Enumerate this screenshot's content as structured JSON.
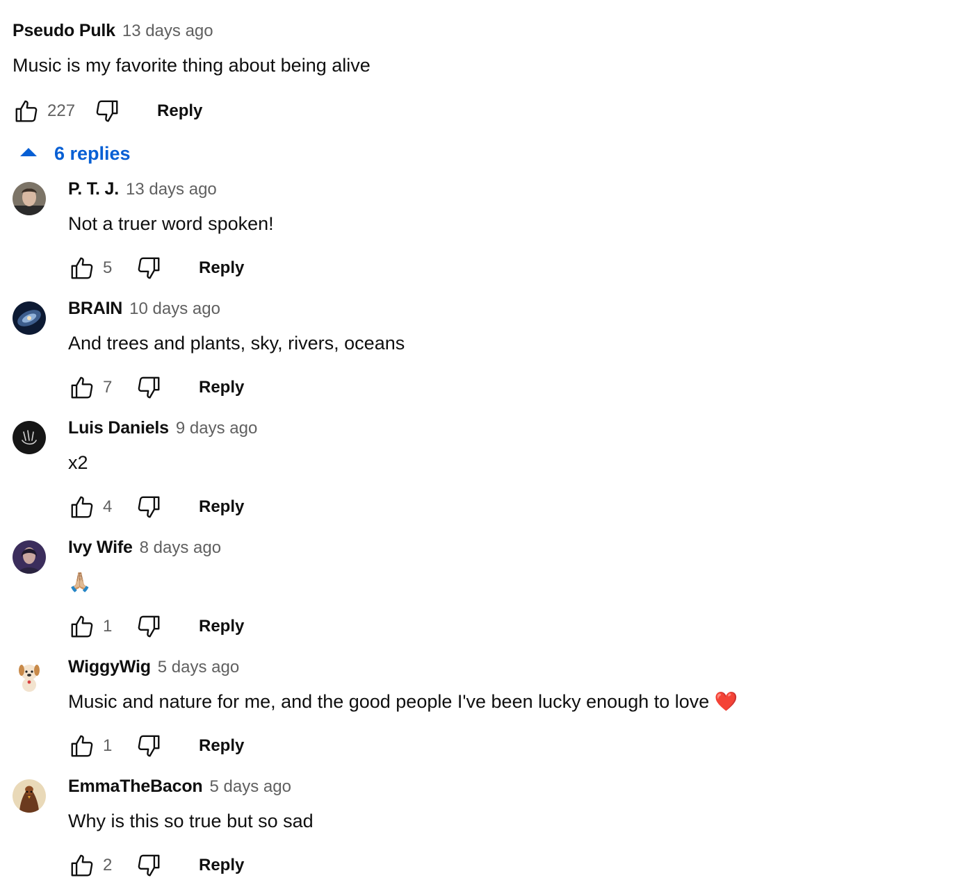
{
  "top_comment": {
    "author": "Pseudo Pulk",
    "time": "13 days ago",
    "text": "Music is my favorite thing about being alive",
    "likes": "227",
    "reply_label": "Reply"
  },
  "replies_toggle": {
    "label": "6 replies",
    "icon": "caret-up-icon",
    "color": "#065fd4"
  },
  "replies": [
    {
      "author": "P. T. J.",
      "time": "13 days ago",
      "text": "Not a truer word spoken!",
      "likes": "5",
      "reply_label": "Reply"
    },
    {
      "author": "BRAIN",
      "time": "10 days ago",
      "text": "And trees and plants, sky, rivers, oceans",
      "likes": "7",
      "reply_label": "Reply"
    },
    {
      "author": "Luis Daniels",
      "time": "9 days ago",
      "text": "x2",
      "likes": "4",
      "reply_label": "Reply"
    },
    {
      "author": "Ivy Wife",
      "time": "8 days ago",
      "text": "🙏🏼",
      "likes": "1",
      "reply_label": "Reply"
    },
    {
      "author": "WiggyWig",
      "time": "5 days ago",
      "text": "Music and nature for me, and the good people I've been lucky enough to love ❤️",
      "likes": "1",
      "reply_label": "Reply"
    },
    {
      "author": "EmmaTheBacon",
      "time": "5 days ago",
      "text": "Why is this so true but so sad",
      "likes": "2",
      "reply_label": "Reply"
    }
  ],
  "icons": {
    "like": "thumbs-up-icon",
    "dislike": "thumbs-down-icon"
  }
}
